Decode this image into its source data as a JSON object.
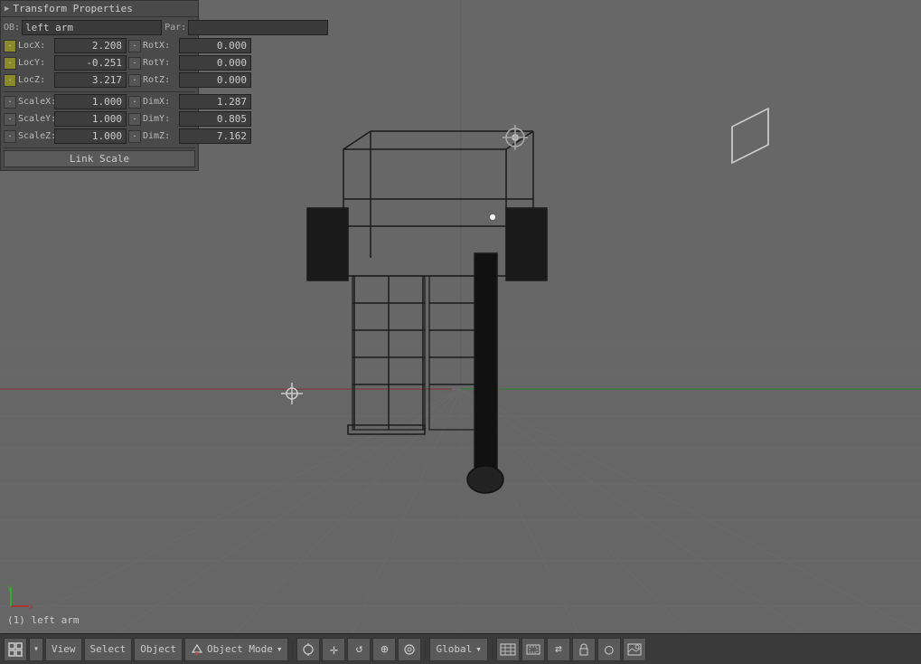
{
  "panel": {
    "title": "Transform Properties",
    "ob_label": "OB:",
    "ob_value": "left arm",
    "par_label": "Par:",
    "par_value": "",
    "loc": {
      "x_label": "LocX:",
      "x_value": "2.208",
      "y_label": "LocY:",
      "y_value": "-0.251",
      "z_label": "LocZ:",
      "z_value": "3.217"
    },
    "rot": {
      "x_label": "RotX:",
      "x_value": "0.000",
      "y_label": "RotY:",
      "y_value": "0.000",
      "z_label": "RotZ:",
      "z_value": "0.000"
    },
    "scale": {
      "x_label": "ScaleX:",
      "x_value": "1.000",
      "y_label": "ScaleY:",
      "y_value": "1.000",
      "z_label": "ScaleZ:",
      "z_value": "1.000"
    },
    "dim": {
      "x_label": "DimX:",
      "x_value": "1.287",
      "y_label": "DimY:",
      "y_value": "0.805",
      "z_label": "DimZ:",
      "z_value": "7.162"
    },
    "link_scale_label": "Link Scale"
  },
  "viewport": {
    "object_name": "(1) left arm"
  },
  "toolbar": {
    "view_toggle": "⊞",
    "view_label": "View",
    "select_label": "Select",
    "object_label": "Object",
    "mode_label": "Object Mode",
    "global_label": "Global",
    "icons": [
      "⊕",
      "▾",
      "☉",
      "◎",
      "△",
      "◈",
      "⊙",
      "≡",
      "▦",
      "⊞",
      "↔",
      "⊟",
      "🔒"
    ]
  },
  "colors": {
    "bg": "#666666",
    "panel_bg": "#4a4a4a",
    "toolbar_bg": "#3a3a3a",
    "grid_line": "#707070",
    "grid_center": "#888888",
    "axis_x": "#aa2222",
    "axis_y": "#22aa22",
    "wireframe": "#111111"
  }
}
